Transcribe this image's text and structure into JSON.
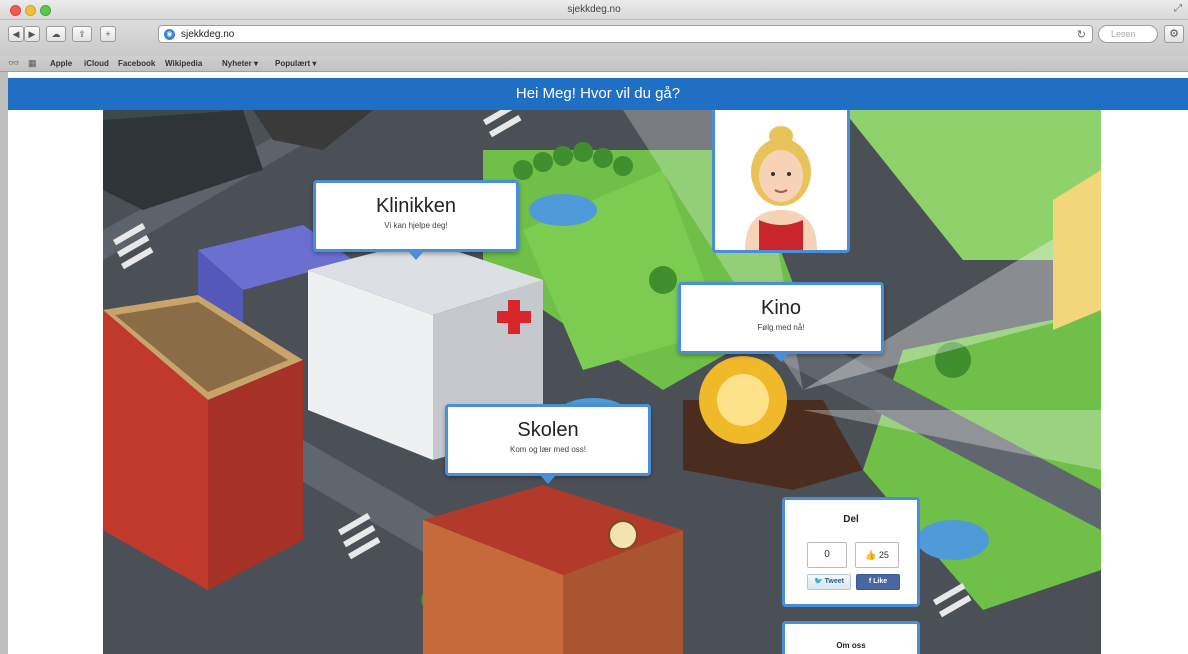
{
  "browser": {
    "window_title": "sjekkdeg.no",
    "url": "sjekkdeg.no",
    "search_placeholder": "Lesen",
    "bookmarks": [
      "Apple",
      "iCloud",
      "Facebook",
      "Wikipedia",
      "Nyheter ▾",
      "Populært ▾"
    ]
  },
  "header": {
    "greeting": "Hei Meg! Hvor vil du gå?"
  },
  "places": {
    "clinic": {
      "title": "Klinikken",
      "subtitle": "Vi kan hjelpe deg!"
    },
    "cinema": {
      "title": "Kino",
      "subtitle": "Følg med nå!"
    },
    "school": {
      "title": "Skolen",
      "subtitle": "Kom og lær med oss!"
    }
  },
  "share": {
    "title": "Del",
    "count": "0",
    "likes": "25",
    "tweet_label": "Tweet",
    "like_label": "Like"
  },
  "about": {
    "label": "Om oss"
  },
  "colors": {
    "header_blue": "#1f6fc4",
    "callout_border": "#4a8ed8",
    "grass": "#6fbf48",
    "road": "#575c63"
  }
}
